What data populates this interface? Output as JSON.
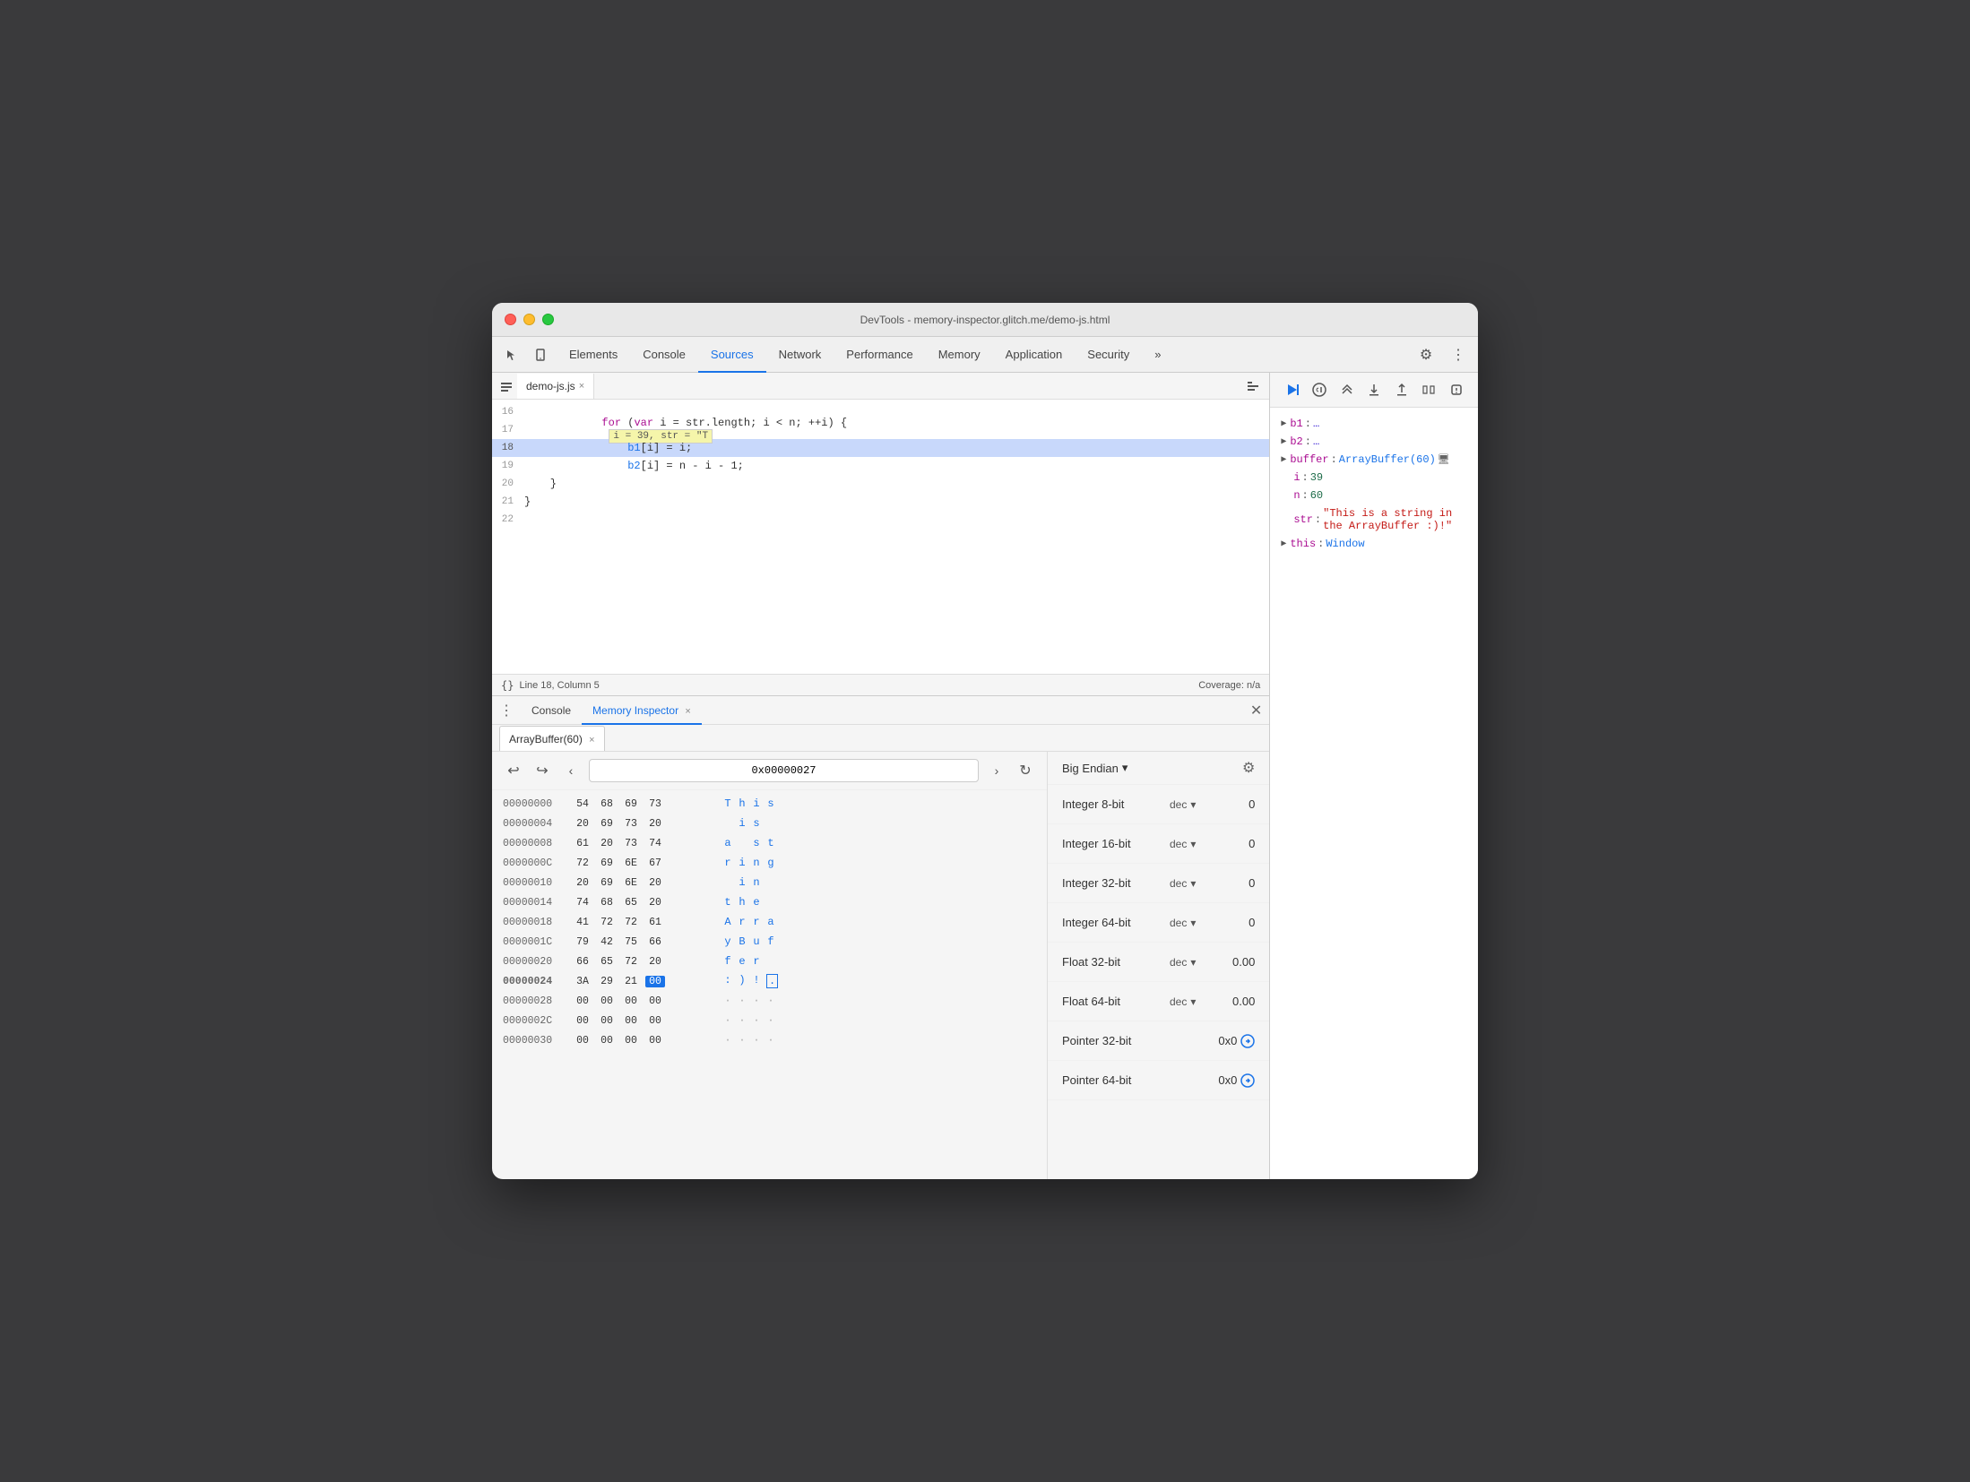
{
  "window": {
    "title": "DevTools - memory-inspector.glitch.me/demo-js.html"
  },
  "tabs": {
    "items": [
      "Elements",
      "Console",
      "Sources",
      "Network",
      "Performance",
      "Memory",
      "Application",
      "Security"
    ],
    "active": "Sources",
    "overflow_label": "»"
  },
  "file_tab": {
    "name": "demo-js.js",
    "close": "×"
  },
  "code": {
    "lines": [
      {
        "num": "16",
        "text": ""
      },
      {
        "num": "17",
        "text": "    for (var i = str.length; i < n; ++i) {",
        "tooltip": "i = 39, str = \"T"
      },
      {
        "num": "18",
        "text": "        b1[i] = i;",
        "highlighted": true
      },
      {
        "num": "19",
        "text": "        b2[i] = n - i - 1;"
      },
      {
        "num": "20",
        "text": "    }"
      },
      {
        "num": "21",
        "text": "}"
      },
      {
        "num": "22",
        "text": ""
      }
    ]
  },
  "status_bar": {
    "left": "Line 18, Column 5",
    "right": "Coverage: n/a",
    "brace_icon": "{}"
  },
  "bottom_tabs": {
    "console_label": "Console",
    "mi_label": "Memory Inspector",
    "mi_close": "×"
  },
  "buffer_tab": {
    "label": "ArrayBuffer(60)",
    "close": "×"
  },
  "address": {
    "value": "0x00000027",
    "back_label": "‹",
    "forward_label": "›",
    "undo_label": "↩",
    "redo_label": "↪",
    "refresh_label": "↻"
  },
  "hex_rows": [
    {
      "addr": "00000000",
      "bytes": [
        "54",
        "68",
        "69",
        "73"
      ],
      "chars": [
        "T",
        "h",
        "i",
        "s"
      ],
      "bold": false
    },
    {
      "addr": "00000004",
      "bytes": [
        "20",
        "69",
        "73",
        "20"
      ],
      "chars": [
        "i",
        "s",
        "",
        ""
      ],
      "bold": false
    },
    {
      "addr": "00000008",
      "bytes": [
        "61",
        "20",
        "73",
        "74"
      ],
      "chars": [
        "a",
        "s",
        "t",
        ""
      ],
      "bold": false
    },
    {
      "addr": "0000000C",
      "bytes": [
        "72",
        "69",
        "6E",
        "67"
      ],
      "chars": [
        "r",
        "i",
        "n",
        "g"
      ],
      "bold": false
    },
    {
      "addr": "00000010",
      "bytes": [
        "20",
        "69",
        "6E",
        "20"
      ],
      "chars": [
        "i",
        "n",
        "",
        ""
      ],
      "bold": false
    },
    {
      "addr": "00000014",
      "bytes": [
        "74",
        "68",
        "65",
        "20"
      ],
      "chars": [
        "t",
        "h",
        "e",
        ""
      ],
      "bold": false
    },
    {
      "addr": "00000018",
      "bytes": [
        "41",
        "72",
        "72",
        "61"
      ],
      "chars": [
        "A",
        "r",
        "r",
        "a"
      ],
      "bold": false
    },
    {
      "addr": "0000001C",
      "bytes": [
        "79",
        "42",
        "75",
        "66"
      ],
      "chars": [
        "y",
        "B",
        "u",
        "f"
      ],
      "bold": false
    },
    {
      "addr": "00000020",
      "bytes": [
        "66",
        "65",
        "72",
        "20"
      ],
      "chars": [
        "f",
        "e",
        "r",
        ""
      ],
      "bold": false
    },
    {
      "addr": "00000024",
      "bytes": [
        "3A",
        "29",
        "21",
        "00"
      ],
      "chars": [
        ":",
        ")",
        ".",
        ""
      ],
      "bold": true,
      "selected_byte_idx": 3
    },
    {
      "addr": "00000028",
      "bytes": [
        "00",
        "00",
        "00",
        "00"
      ],
      "chars": [
        ".",
        ".",
        ".",
        "."
      ],
      "bold": false
    },
    {
      "addr": "0000002C",
      "bytes": [
        "00",
        "00",
        "00",
        "00"
      ],
      "chars": [
        ".",
        ".",
        ".",
        "."
      ],
      "bold": false
    },
    {
      "addr": "00000030",
      "bytes": [
        "00",
        "00",
        "00",
        "00"
      ],
      "chars": [
        ".",
        ".",
        ".",
        "."
      ],
      "bold": false
    }
  ],
  "endian": {
    "label": "Big Endian",
    "arrow": "▾"
  },
  "value_rows": [
    {
      "label": "Integer 8-bit",
      "format": "dec",
      "value": "0"
    },
    {
      "label": "Integer 16-bit",
      "format": "dec",
      "value": "0"
    },
    {
      "label": "Integer 32-bit",
      "format": "dec",
      "value": "0"
    },
    {
      "label": "Integer 64-bit",
      "format": "dec",
      "value": "0"
    },
    {
      "label": "Float 32-bit",
      "format": "dec",
      "value": "0.00"
    },
    {
      "label": "Float 64-bit",
      "format": "dec",
      "value": "0.00"
    },
    {
      "label": "Pointer 32-bit",
      "format": "",
      "value": "0x0",
      "link": true
    },
    {
      "label": "Pointer 64-bit",
      "format": "",
      "value": "0x0",
      "link": true
    }
  ],
  "debug": {
    "scope_items": [
      {
        "label": "b1",
        "value": "…",
        "arrow": true
      },
      {
        "label": "b2",
        "value": "…",
        "arrow": true
      },
      {
        "label": "buffer",
        "value": "ArrayBuffer(60)",
        "arrow": true,
        "icon": "🖥"
      },
      {
        "label": "i",
        "value": "39",
        "arrow": false,
        "num": true
      },
      {
        "label": "n",
        "value": "60",
        "arrow": false,
        "num": true
      },
      {
        "label": "str",
        "value": "\"This is a string in the ArrayBuffer :)!\"",
        "arrow": false,
        "string": true
      },
      {
        "label": "this",
        "value": "Window",
        "arrow": true
      }
    ]
  }
}
